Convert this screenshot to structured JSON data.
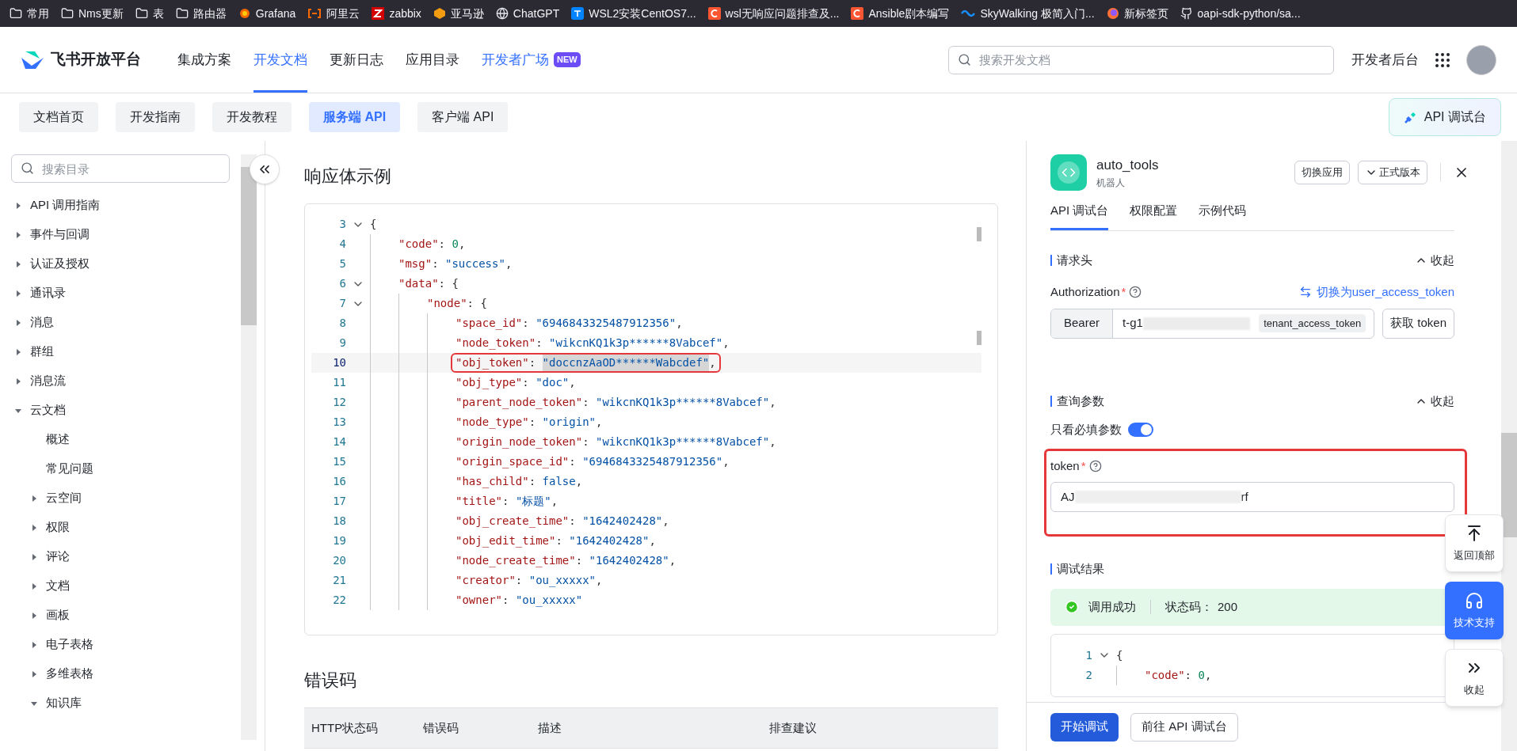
{
  "bookmarks": [
    {
      "kind": "folder",
      "label": "常用"
    },
    {
      "kind": "folder",
      "label": "Nms更新"
    },
    {
      "kind": "folder",
      "label": "表"
    },
    {
      "kind": "folder",
      "label": "路由器"
    },
    {
      "kind": "grafana",
      "label": "Grafana"
    },
    {
      "kind": "aliyun",
      "label": "阿里云"
    },
    {
      "kind": "zabbix",
      "label": "zabbix"
    },
    {
      "kind": "amazon",
      "label": "亚马逊"
    },
    {
      "kind": "globe",
      "label": "ChatGPT"
    },
    {
      "kind": "zhihu",
      "label": "WSL2安装CentOS7..."
    },
    {
      "kind": "csdn",
      "label": "wsl无响应问题排查及..."
    },
    {
      "kind": "csdn",
      "label": "Ansible剧本编写"
    },
    {
      "kind": "skywalking",
      "label": "SkyWalking 极简入门..."
    },
    {
      "kind": "firefox",
      "label": "新标签页"
    },
    {
      "kind": "github",
      "label": "oapi-sdk-python/sa..."
    }
  ],
  "nav": {
    "logo": "飞书开放平台",
    "items": [
      {
        "label": "集成方案",
        "selected": false
      },
      {
        "label": "开发文档",
        "selected": true
      },
      {
        "label": "更新日志",
        "selected": false
      },
      {
        "label": "应用目录",
        "selected": false
      },
      {
        "label": "开发者广场",
        "selected": false,
        "badge": "NEW"
      }
    ],
    "search": {
      "placeholder": "搜索开发文档"
    },
    "console": "开发者后台"
  },
  "subtabs": [
    {
      "label": "文档首页",
      "selected": false
    },
    {
      "label": "开发指南",
      "selected": false
    },
    {
      "label": "开发教程",
      "selected": false
    },
    {
      "label": "服务端 API",
      "selected": true
    },
    {
      "label": "客户端 API",
      "selected": false
    }
  ],
  "api_console_button": "API 调试台",
  "sidebar": {
    "search": {
      "placeholder": "搜索目录"
    },
    "items": [
      {
        "label": "API 调用指南",
        "expanded": false
      },
      {
        "label": "事件与回调",
        "expanded": false
      },
      {
        "label": "认证及授权",
        "expanded": false
      },
      {
        "label": "通讯录",
        "expanded": false
      },
      {
        "label": "消息",
        "expanded": false
      },
      {
        "label": "群组",
        "expanded": false
      },
      {
        "label": "消息流",
        "expanded": false
      },
      {
        "label": "云文档",
        "expanded": true,
        "children": [
          {
            "label": "概述",
            "kind": "leaf"
          },
          {
            "label": "常见问题",
            "kind": "leaf"
          },
          {
            "label": "云空间",
            "expanded": false
          },
          {
            "label": "权限",
            "expanded": false
          },
          {
            "label": "评论",
            "expanded": false
          },
          {
            "label": "文档",
            "expanded": false
          },
          {
            "label": "画板",
            "expanded": false
          },
          {
            "label": "电子表格",
            "expanded": false
          },
          {
            "label": "多维表格",
            "expanded": false
          },
          {
            "label": "知识库",
            "expanded": true
          }
        ]
      }
    ]
  },
  "content": {
    "title": "响应体示例",
    "code": [
      {
        "number": "3",
        "fold": true,
        "annotated": false,
        "tokens": [
          {
            "kind": "punct",
            "text": "{"
          }
        ]
      },
      {
        "number": "4",
        "fold": false,
        "annotated": false,
        "tokens": [
          {
            "kind": "key",
            "text": "\"code\""
          },
          {
            "kind": "punct",
            "text": ": "
          },
          {
            "kind": "number",
            "text": "0"
          },
          {
            "kind": "punct",
            "text": ","
          }
        ]
      },
      {
        "number": "5",
        "fold": false,
        "annotated": false,
        "tokens": [
          {
            "kind": "key",
            "text": "\"msg\""
          },
          {
            "kind": "punct",
            "text": ": "
          },
          {
            "kind": "string",
            "text": "\"success\""
          },
          {
            "kind": "punct",
            "text": ","
          }
        ]
      },
      {
        "number": "6",
        "fold": true,
        "annotated": false,
        "tokens": [
          {
            "kind": "key",
            "text": "\"data\""
          },
          {
            "kind": "punct",
            "text": ": {"
          }
        ]
      },
      {
        "number": "7",
        "fold": true,
        "annotated": false,
        "tokens": [
          {
            "kind": "key",
            "text": "\"node\""
          },
          {
            "kind": "punct",
            "text": ": {"
          }
        ]
      },
      {
        "number": "8",
        "fold": false,
        "annotated": false,
        "tokens": [
          {
            "kind": "key",
            "text": "\"space_id\""
          },
          {
            "kind": "punct",
            "text": ": "
          },
          {
            "kind": "string",
            "text": "\"6946843325487912356\""
          },
          {
            "kind": "punct",
            "text": ","
          }
        ]
      },
      {
        "number": "9",
        "fold": false,
        "annotated": false,
        "tokens": [
          {
            "kind": "key",
            "text": "\"node_token\""
          },
          {
            "kind": "punct",
            "text": ": "
          },
          {
            "kind": "string",
            "text": "\"wikcnKQ1k3p******8Vabcef\""
          },
          {
            "kind": "punct",
            "text": ","
          }
        ]
      },
      {
        "number": "10",
        "fold": false,
        "annotated": true,
        "tokens": [
          {
            "kind": "key",
            "text": "\"obj_token\""
          },
          {
            "kind": "punct",
            "text": ": "
          },
          {
            "kind": "string",
            "text": "\"doccnzAaOD******Wabcdef\""
          },
          {
            "kind": "punct",
            "text": ","
          }
        ]
      },
      {
        "number": "11",
        "fold": false,
        "annotated": false,
        "tokens": [
          {
            "kind": "key",
            "text": "\"obj_type\""
          },
          {
            "kind": "punct",
            "text": ": "
          },
          {
            "kind": "string",
            "text": "\"doc\""
          },
          {
            "kind": "punct",
            "text": ","
          }
        ]
      },
      {
        "number": "12",
        "fold": false,
        "annotated": false,
        "tokens": [
          {
            "kind": "key",
            "text": "\"parent_node_token\""
          },
          {
            "kind": "punct",
            "text": ": "
          },
          {
            "kind": "string",
            "text": "\"wikcnKQ1k3p******8Vabcef\""
          },
          {
            "kind": "punct",
            "text": ","
          }
        ]
      },
      {
        "number": "13",
        "fold": false,
        "annotated": false,
        "tokens": [
          {
            "kind": "key",
            "text": "\"node_type\""
          },
          {
            "kind": "punct",
            "text": ": "
          },
          {
            "kind": "string",
            "text": "\"origin\""
          },
          {
            "kind": "punct",
            "text": ","
          }
        ]
      },
      {
        "number": "14",
        "fold": false,
        "annotated": false,
        "tokens": [
          {
            "kind": "key",
            "text": "\"origin_node_token\""
          },
          {
            "kind": "punct",
            "text": ": "
          },
          {
            "kind": "string",
            "text": "\"wikcnKQ1k3p******8Vabcef\""
          },
          {
            "kind": "punct",
            "text": ","
          }
        ]
      },
      {
        "number": "15",
        "fold": false,
        "annotated": false,
        "tokens": [
          {
            "kind": "key",
            "text": "\"origin_space_id\""
          },
          {
            "kind": "punct",
            "text": ": "
          },
          {
            "kind": "string",
            "text": "\"6946843325487912356\""
          },
          {
            "kind": "punct",
            "text": ","
          }
        ]
      },
      {
        "number": "16",
        "fold": false,
        "annotated": false,
        "tokens": [
          {
            "kind": "key",
            "text": "\"has_child\""
          },
          {
            "kind": "punct",
            "text": ": "
          },
          {
            "kind": "keyword",
            "text": "false"
          },
          {
            "kind": "punct",
            "text": ","
          }
        ]
      },
      {
        "number": "17",
        "fold": false,
        "annotated": false,
        "tokens": [
          {
            "kind": "key",
            "text": "\"title\""
          },
          {
            "kind": "punct",
            "text": ": "
          },
          {
            "kind": "string",
            "text": "\"标题\""
          },
          {
            "kind": "punct",
            "text": ","
          }
        ]
      },
      {
        "number": "18",
        "fold": false,
        "annotated": false,
        "tokens": [
          {
            "kind": "key",
            "text": "\"obj_create_time\""
          },
          {
            "kind": "punct",
            "text": ": "
          },
          {
            "kind": "string",
            "text": "\"1642402428\""
          },
          {
            "kind": "punct",
            "text": ","
          }
        ]
      },
      {
        "number": "19",
        "fold": false,
        "annotated": false,
        "tokens": [
          {
            "kind": "key",
            "text": "\"obj_edit_time\""
          },
          {
            "kind": "punct",
            "text": ": "
          },
          {
            "kind": "string",
            "text": "\"1642402428\""
          },
          {
            "kind": "punct",
            "text": ","
          }
        ]
      },
      {
        "number": "20",
        "fold": false,
        "annotated": false,
        "tokens": [
          {
            "kind": "key",
            "text": "\"node_create_time\""
          },
          {
            "kind": "punct",
            "text": ": "
          },
          {
            "kind": "string",
            "text": "\"1642402428\""
          },
          {
            "kind": "punct",
            "text": ","
          }
        ]
      },
      {
        "number": "21",
        "fold": false,
        "annotated": false,
        "tokens": [
          {
            "kind": "key",
            "text": "\"creator\""
          },
          {
            "kind": "punct",
            "text": ": "
          },
          {
            "kind": "string",
            "text": "\"ou_xxxxx\""
          },
          {
            "kind": "punct",
            "text": ","
          }
        ]
      },
      {
        "number": "22",
        "fold": false,
        "annotated": false,
        "tokens": [
          {
            "kind": "key",
            "text": "\"owner\""
          },
          {
            "kind": "punct",
            "text": ": "
          },
          {
            "kind": "string",
            "text": "\"ou_xxxxx\""
          }
        ]
      }
    ],
    "errors_title": "错误码",
    "error_columns": [
      "HTTP状态码",
      "错误码",
      "描述",
      "排查建议"
    ]
  },
  "panel": {
    "app_name": "auto_tools",
    "app_type": "机器人",
    "switch_app": "切换应用",
    "version": "正式版本",
    "tabs": [
      {
        "label": "API 调试台",
        "selected": true
      },
      {
        "label": "权限配置",
        "selected": false
      },
      {
        "label": "示例代码",
        "selected": false
      }
    ],
    "headers": {
      "title": "请求头",
      "collapse": "收起",
      "label": "Authorization",
      "required": "*",
      "switch_link": "切换为user_access_token",
      "prefix": "Bearer",
      "value": "t-g1",
      "token_type": "tenant_access_token",
      "get_token": "获取 token"
    },
    "query": {
      "title": "查询参数",
      "collapse": "收起",
      "required_only": {
        "label": "只看必填参数",
        "on": true
      },
      "label": "token",
      "required": "*",
      "value_start": "AJ",
      "value_end": "rf"
    },
    "result": {
      "title": "调试结果",
      "status": "调用成功",
      "code_label": "状态码：",
      "code": "200",
      "lines": [
        {
          "number": "1",
          "fold": true,
          "tokens": [
            {
              "kind": "punct",
              "text": "{"
            }
          ]
        },
        {
          "number": "2",
          "fold": false,
          "tokens": [
            {
              "kind": "key",
              "text": "\"code\""
            },
            {
              "kind": "punct",
              "text": ": "
            },
            {
              "kind": "number",
              "text": "0"
            },
            {
              "kind": "punct",
              "text": ","
            }
          ]
        }
      ]
    },
    "run": "开始调试",
    "goto": "前往 API 调试台"
  },
  "float_buttons": [
    {
      "kind": "top",
      "label": "返回顶部"
    },
    {
      "kind": "support",
      "label": "技术支持"
    },
    {
      "kind": "collapse",
      "label": "收起"
    }
  ]
}
